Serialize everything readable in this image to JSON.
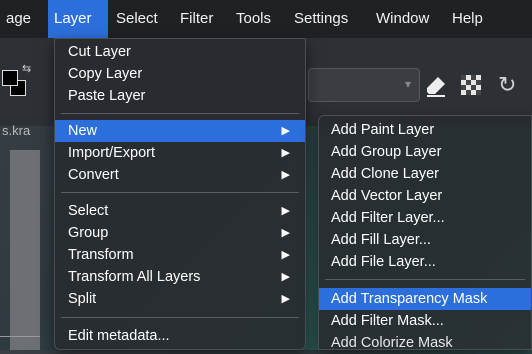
{
  "menubar": {
    "items": [
      {
        "label": "age",
        "active": false
      },
      {
        "label": "Layer",
        "active": true
      },
      {
        "label": "Select",
        "active": false
      },
      {
        "label": "Filter",
        "active": false
      },
      {
        "label": "Tools",
        "active": false
      },
      {
        "label": "Settings",
        "active": false
      },
      {
        "label": "Window",
        "active": false
      },
      {
        "label": "Help",
        "active": false
      }
    ]
  },
  "background": {
    "tab_label": "s.kra"
  },
  "layer_menu": {
    "cut": "Cut Layer",
    "copy": "Copy Layer",
    "paste": "Paste Layer",
    "new": "New",
    "import_export": "Import/Export",
    "convert": "Convert",
    "select": "Select",
    "group": "Group",
    "transform": "Transform",
    "transform_all": "Transform All Layers",
    "split": "Split",
    "edit_metadata": "Edit metadata..."
  },
  "new_menu": {
    "paint": "Add Paint Layer",
    "group": "Add Group Layer",
    "clone": "Add Clone Layer",
    "vector": "Add Vector Layer",
    "filter": "Add Filter Layer...",
    "fill": "Add Fill Layer...",
    "file": "Add File Layer...",
    "transparency_mask": "Add Transparency Mask",
    "filter_mask": "Add Filter Mask...",
    "colorize_mask": "Add Colorize Mask"
  },
  "colors": {
    "highlight": "#2c6fdc",
    "menubar": "#1f2124",
    "menu_bg": "#282c30"
  }
}
